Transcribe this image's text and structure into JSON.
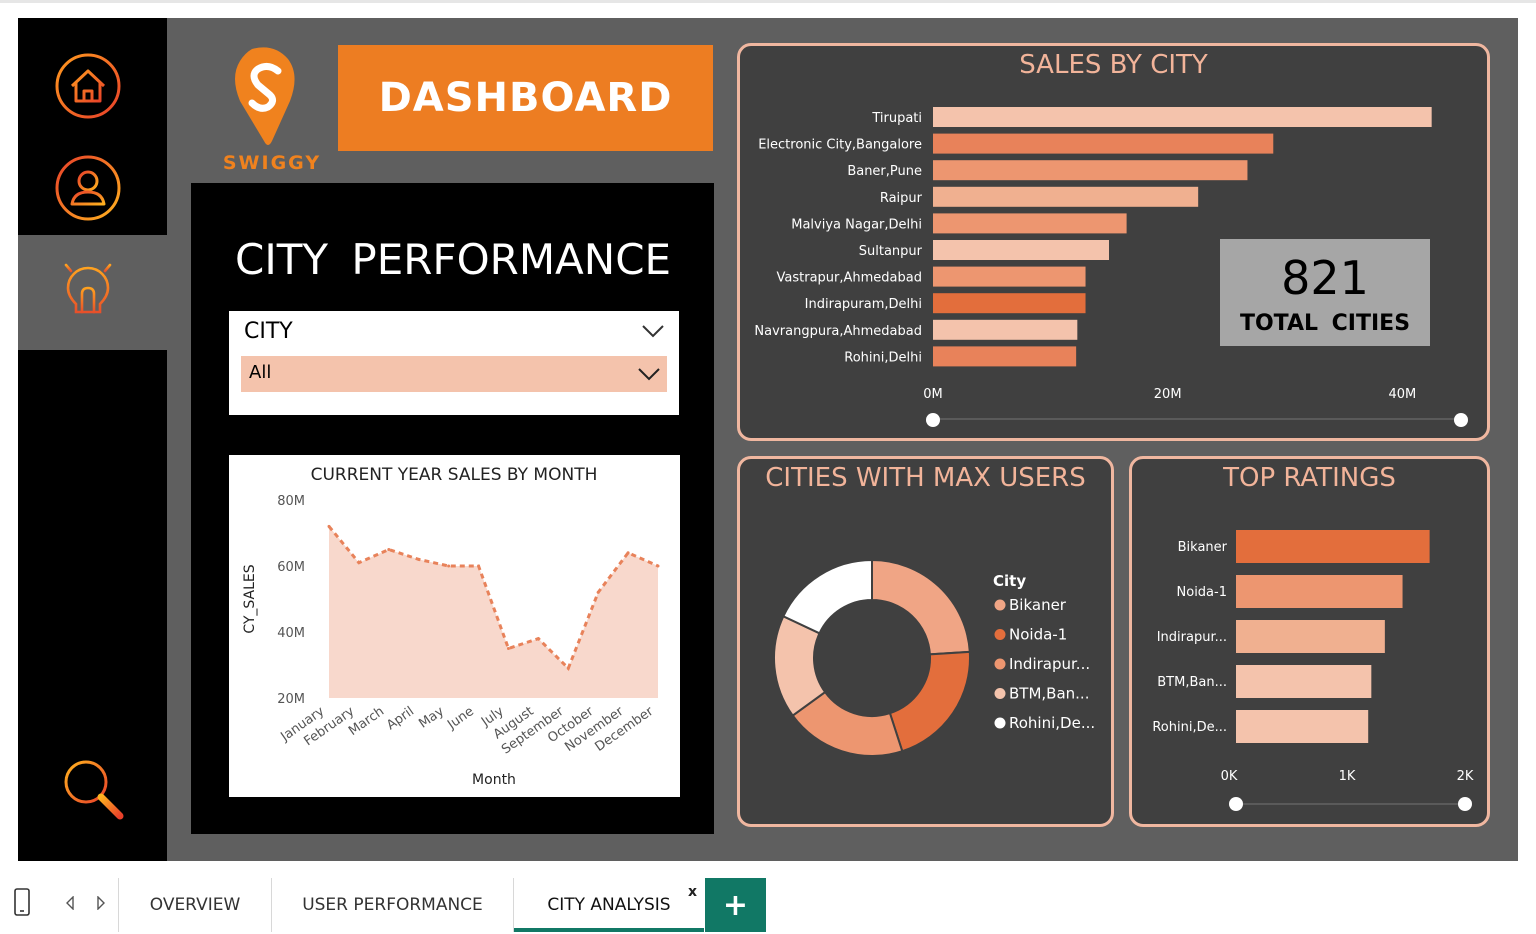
{
  "brand": {
    "name": "SWIGGY",
    "accent": "#ed7d22"
  },
  "header": {
    "title": "DASHBOARD"
  },
  "sidebar": {
    "items": [
      {
        "icon": "home-icon"
      },
      {
        "icon": "user-icon"
      },
      {
        "icon": "lightbulb-icon",
        "active": true
      },
      {
        "icon": "search-icon"
      }
    ]
  },
  "city_panel": {
    "title": "CITY  PERFORMANCE",
    "slicer": {
      "label": "CITY",
      "selected": "All"
    }
  },
  "monthly_chart": {
    "chart_data": {
      "type": "area",
      "title": "CURRENT YEAR SALES BY MONTH",
      "xlabel": "Month",
      "ylabel": "CY_SALES",
      "categories": [
        "January",
        "February",
        "March",
        "April",
        "May",
        "June",
        "July",
        "August",
        "September",
        "October",
        "November",
        "December"
      ],
      "values": [
        72,
        61,
        65,
        62,
        60,
        60,
        35,
        38,
        29,
        52,
        64,
        60
      ],
      "yticks": [
        "20M",
        "40M",
        "60M",
        "80M"
      ],
      "ylim": [
        20,
        80
      ],
      "color": "#f8d8cc"
    }
  },
  "sales_by_city": {
    "chart_data": {
      "type": "bar",
      "title": "SALES BY CITY",
      "categories": [
        "Tirupati",
        "Electronic City,Bangalore",
        "Baner,Pune",
        "Raipur",
        "Malviya Nagar,Delhi",
        "Sultanpur",
        "Vastrapur,Ahmedabad",
        "Indirapuram,Delhi",
        "Navrangpura,Ahmedabad",
        "Rohini,Delhi"
      ],
      "values": [
        42.5,
        29,
        26.8,
        22.6,
        16.5,
        15,
        13,
        13,
        12.3,
        12.2
      ],
      "colors": [
        "#f4c3ac",
        "#e8825a",
        "#ed9670",
        "#f0b090",
        "#ed9670",
        "#f4c3ac",
        "#ed9670",
        "#e36e3c",
        "#f4c3ac",
        "#e8825a"
      ],
      "xticks": [
        "0M",
        "20M",
        "40M"
      ],
      "xlim": [
        0,
        45
      ]
    }
  },
  "kpi": {
    "value": "821",
    "label": "TOTAL CITIES"
  },
  "max_users": {
    "chart_data": {
      "type": "pie",
      "title": "CITIES WITH MAX USERS",
      "legend_title": "City",
      "categories": [
        "Bikaner",
        "Noida-1",
        "Indirapur...",
        "BTM,Ban...",
        "Rohini,De..."
      ],
      "values": [
        24,
        21,
        20,
        17,
        18
      ],
      "colors": [
        "#f0a585",
        "#e36e3c",
        "#ed9670",
        "#f4c3ac",
        "#ffffff"
      ]
    }
  },
  "top_ratings": {
    "chart_data": {
      "type": "bar",
      "title": "TOP RATINGS",
      "categories": [
        "Bikaner",
        "Noida-1",
        "Indirapur...",
        "BTM,Ban...",
        "Rohini,De..."
      ],
      "values": [
        1.86,
        1.6,
        1.43,
        1.3,
        1.27
      ],
      "colors": [
        "#e36e3c",
        "#ed9670",
        "#f0b090",
        "#f4c3ac",
        "#f4c3ac"
      ],
      "xticks": [
        "0K",
        "1K",
        "2K"
      ],
      "xlim": [
        0,
        2.2
      ]
    }
  },
  "tabs": {
    "items": [
      {
        "label": "OVERVIEW"
      },
      {
        "label": "USER PERFORMANCE"
      },
      {
        "label": "CITY ANALYSIS",
        "active": true
      }
    ],
    "close_label": "x",
    "add_label": "+"
  }
}
